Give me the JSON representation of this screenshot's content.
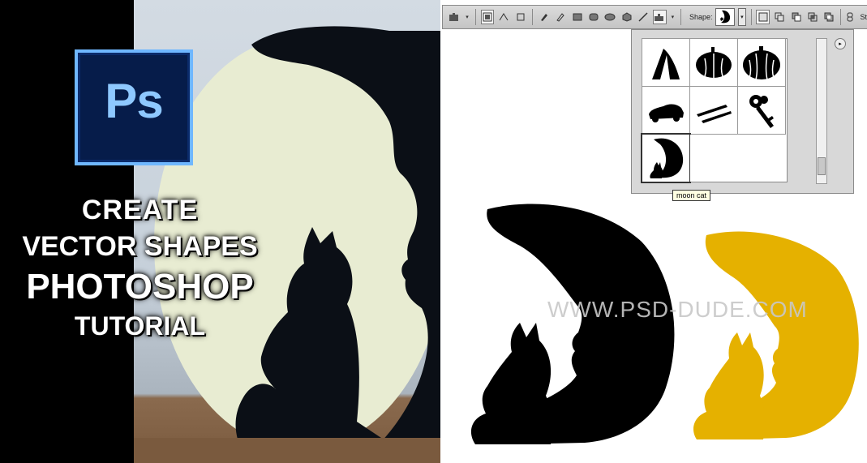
{
  "left_panel": {
    "logo_text": "Ps",
    "title_lines": [
      "CREATE",
      "VECTOR SHAPES",
      "PHOTOSHOP",
      "TUTORIAL"
    ]
  },
  "toolbar": {
    "shape_label": "Shape:",
    "style_label": "St"
  },
  "shape_picker": {
    "shapes": [
      "tent-shape",
      "pumpkin-shape",
      "pumpkin-shape-2",
      "car-shape",
      "dash-shape",
      "key-shape",
      "moon-cat-shape"
    ],
    "selected": "moon-cat-shape",
    "tooltip": "moon cat"
  },
  "watermark": "WWW.PSD-DUDE.COM",
  "colors": {
    "black_shape": "#000000",
    "yellow_shape": "#e5b100",
    "logo_bg": "#061c4a",
    "logo_border": "#6fb7ff",
    "logo_text": "#8ec8ff"
  }
}
